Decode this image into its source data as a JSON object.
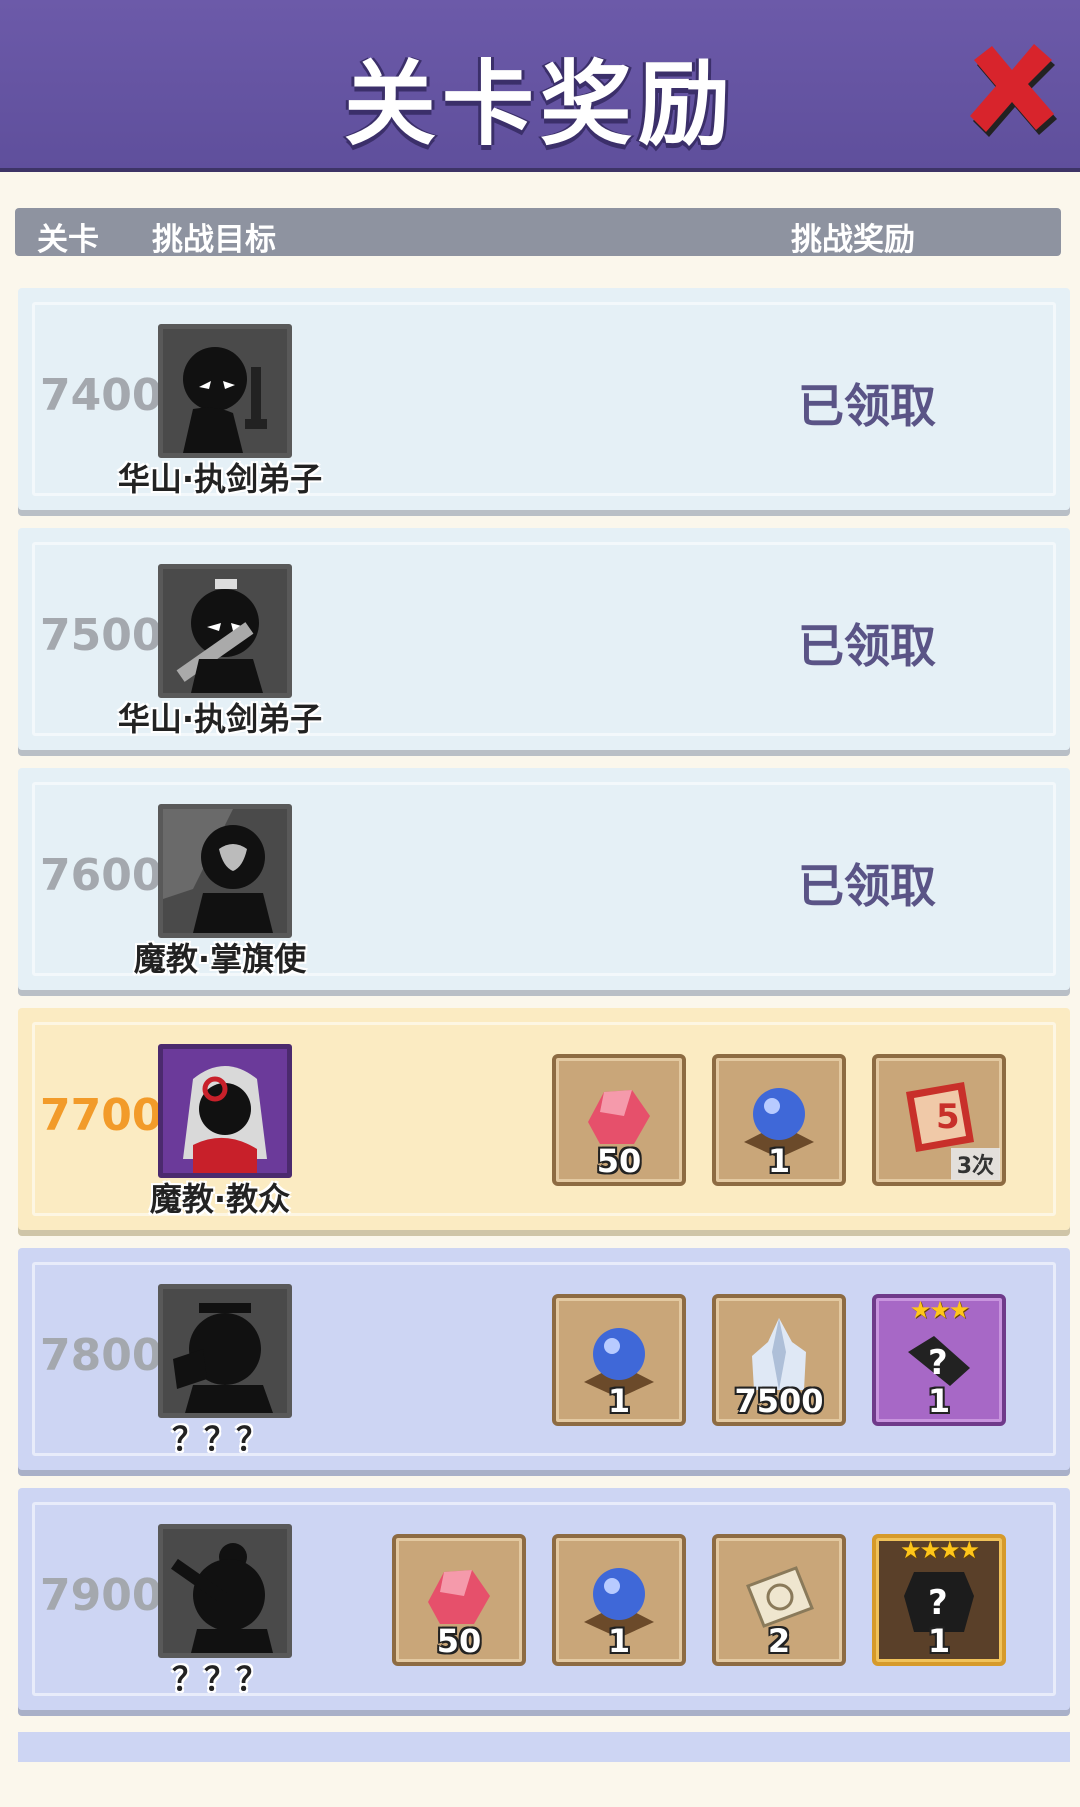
{
  "title": "关卡奖励",
  "header": {
    "col_level": "关卡",
    "col_target": "挑战目标",
    "col_reward": "挑战奖励"
  },
  "rows": [
    {
      "level": "7400",
      "enemy": "华山·执剑弟子",
      "status": "已领取"
    },
    {
      "level": "7500",
      "enemy": "华山·执剑弟子",
      "status": "已领取"
    },
    {
      "level": "7600",
      "enemy": "魔教·掌旗使",
      "status": "已领取"
    },
    {
      "level": "7700",
      "enemy": "魔教·教众",
      "rewards": [
        {
          "icon": "red-gem-icon",
          "qty": "50"
        },
        {
          "icon": "blue-orb-icon",
          "qty": "1"
        },
        {
          "icon": "voucher-5-icon",
          "times": "3次"
        }
      ]
    },
    {
      "level": "7800",
      "enemy": "？？？",
      "rewards": [
        {
          "icon": "blue-orb-icon",
          "qty": "1"
        },
        {
          "icon": "silver-crystal-icon",
          "qty": "7500"
        },
        {
          "icon": "mystery-weapon-icon",
          "qty": "1",
          "stars": "★★★"
        }
      ]
    },
    {
      "level": "7900",
      "enemy": "？？？",
      "rewards": [
        {
          "icon": "red-gem-icon",
          "qty": "50"
        },
        {
          "icon": "blue-orb-icon",
          "qty": "1"
        },
        {
          "icon": "scroll-icon",
          "qty": "2"
        },
        {
          "icon": "mystery-armor-icon",
          "qty": "1",
          "stars": "★★★★"
        }
      ]
    }
  ],
  "colors": {
    "title_bar": "#6c5aa9",
    "claimed_row": "#e5f0f6",
    "current_row": "#fbebc2",
    "locked_row": "#cdd5f3",
    "current_level": "#f29b2a",
    "close_red": "#d8242c"
  }
}
